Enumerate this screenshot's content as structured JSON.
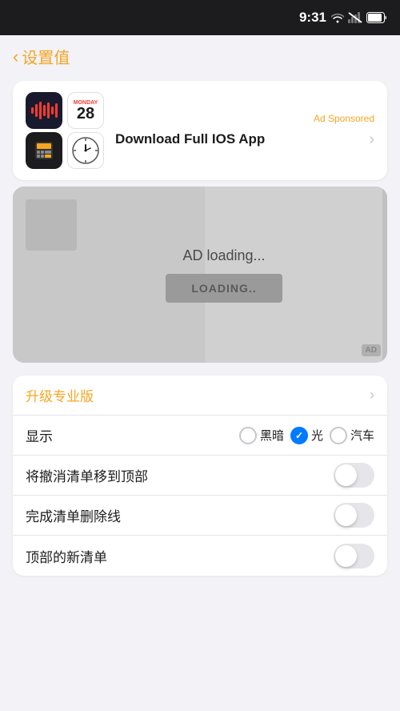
{
  "statusBar": {
    "time": "9:31",
    "icons": [
      "wifi",
      "signal-blocked",
      "battery"
    ]
  },
  "header": {
    "backLabel": "设置值",
    "backArrow": "‹"
  },
  "adCard": {
    "sponsoredLabel": "Ad Sponsored",
    "downloadLabel": "Download Full IOS App",
    "calendar": {
      "day": "Monday",
      "date": "28"
    }
  },
  "adLoading": {
    "loadingText": "AD loading...",
    "loadingBtn": "LOADING..",
    "adBadge": "AD"
  },
  "settings": {
    "upgradeLabel": "升级专业版",
    "displayLabel": "显示",
    "displayOptions": [
      {
        "id": "dark",
        "label": "黑暗",
        "selected": false
      },
      {
        "id": "light",
        "label": "光",
        "selected": true
      },
      {
        "id": "auto",
        "label": "汽车",
        "selected": false
      }
    ],
    "row3Label": "将撤消清单移到顶部",
    "row4Label": "完成清单删除线",
    "row5Label": "顶部的新清单"
  }
}
